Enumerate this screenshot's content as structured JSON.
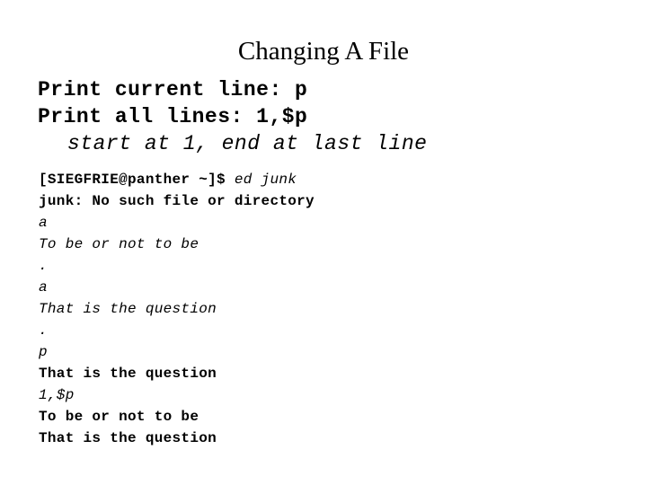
{
  "slide": {
    "title": "Changing A File"
  },
  "bullets": [
    {
      "text": "Print current line: p",
      "style": "bold"
    },
    {
      "text": "Print all lines: 1,$p",
      "style": "bold"
    },
    {
      "text": "start at 1, end at last line",
      "style": "italic"
    }
  ],
  "terminal": {
    "lines": [
      {
        "style": "mixed",
        "segments": [
          {
            "text": "[SIEGFRIE@panther ~]$ ",
            "style": "bold"
          },
          {
            "text": "ed junk",
            "style": "italic"
          }
        ]
      },
      {
        "style": "bold",
        "text": "junk: No such file or directory"
      },
      {
        "style": "italic",
        "text": "a"
      },
      {
        "style": "italic",
        "text": "To be or not to be"
      },
      {
        "style": "italic",
        "text": "."
      },
      {
        "style": "italic",
        "text": "a"
      },
      {
        "style": "italic",
        "text": "That is the question"
      },
      {
        "style": "italic",
        "text": "."
      },
      {
        "style": "italic",
        "text": "p"
      },
      {
        "style": "bold",
        "text": "That is the question"
      },
      {
        "style": "italic",
        "text": "1,$p"
      },
      {
        "style": "bold",
        "text": "To be or not to be"
      },
      {
        "style": "bold",
        "text": "That is the question"
      }
    ]
  }
}
